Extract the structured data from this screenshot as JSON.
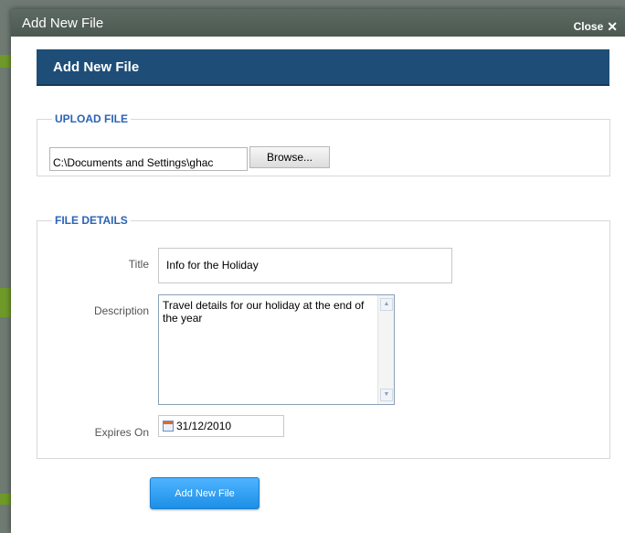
{
  "modal": {
    "title": "Add New File",
    "close_label": "Close",
    "close_icon": "x-icon"
  },
  "panel": {
    "header": "Add New File"
  },
  "upload": {
    "legend": "UPLOAD FILE",
    "file_path": "C:\\Documents and Settings\\ghac",
    "browse_label": "Browse..."
  },
  "details": {
    "legend": "FILE DETAILS",
    "title_label": "Title",
    "title_value": "Info for the Holiday",
    "description_label": "Description",
    "description_value": "Travel details for our holiday at the end of the year",
    "expires_label": "Expires On",
    "expires_value": "31/12/2010",
    "expires_icon": "calendar-icon"
  },
  "submit_label": "Add New File",
  "colors": {
    "header_bg": "#1e4e78",
    "legend_text": "#2b63b5",
    "submit_bg": "#2a9cf0",
    "titlebar_bg": "#56635b"
  }
}
